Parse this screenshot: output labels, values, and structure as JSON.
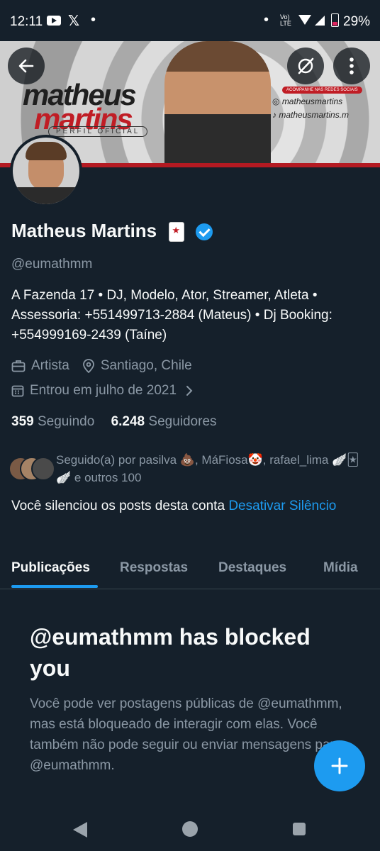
{
  "status_bar": {
    "time": "12:11",
    "x_glyph": "𝕏",
    "lte_label": "Vo)\nLTE",
    "battery_pct": "29%"
  },
  "banner": {
    "brand_line1": "matheus",
    "brand_line2": "martins",
    "brand_line3": "PERFIL OFICIAL",
    "social_tag": "ACOMPANHE NAS REDES SOCIAIS",
    "instagram": "matheusmartins",
    "tiktok": "matheusmartins.m"
  },
  "profile": {
    "name": "Matheus Martins",
    "handle": "@eumathmm",
    "bio": "A Fazenda 17 • DJ, Modelo, Ator, Streamer, Atleta • Assessoria: +551499713-2884 (Mateus) • Dj Booking: +554999169-2439 (Taíne)",
    "category": "Artista",
    "location": "Santiago, Chile",
    "joined": "Entrou em julho de 2021",
    "following_count": "359",
    "following_label": "Seguindo",
    "followers_count": "6.248",
    "followers_label": "Seguidores",
    "followed_by_text": "Seguido(a) por pasilva 💩, MáFiosa🤡, rafael_lima 🪽🃏🪽 e outros 100",
    "muted_text": "Você silenciou os posts desta conta",
    "unmute_link": "Desativar Silêncio"
  },
  "tabs": [
    {
      "label": "Publicações",
      "active": true
    },
    {
      "label": "Respostas",
      "active": false
    },
    {
      "label": "Destaques",
      "active": false
    },
    {
      "label": "Mídia",
      "active": false
    }
  ],
  "blocked": {
    "title": "@eumathmm has blocked you",
    "description": "Você pode ver postagens públicas de @eumathmm, mas está bloqueado de interagir com elas. Você também não pode seguir ou enviar mensagens para @eumathmm."
  },
  "colors": {
    "background": "#15202b",
    "accent": "#1d9bf0",
    "muted_text": "#8b98a5",
    "brand_red": "#c01d25"
  },
  "icons": [
    "back-arrow-icon",
    "grok-icon",
    "more-vertical-icon",
    "verified-badge-icon",
    "briefcase-icon",
    "location-pin-icon",
    "calendar-icon",
    "chevron-right-icon",
    "plus-icon"
  ]
}
